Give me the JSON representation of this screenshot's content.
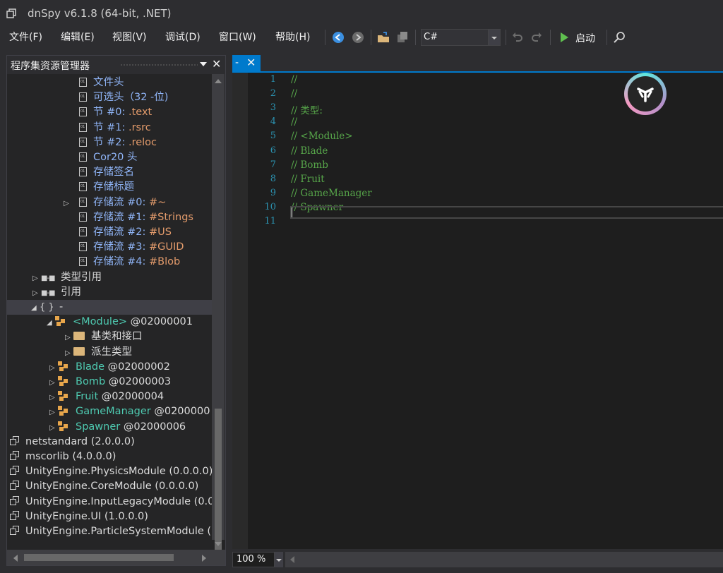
{
  "window": {
    "title": "dnSpy v6.1.8 (64-bit, .NET)"
  },
  "menu": [
    {
      "label": "文件(F)"
    },
    {
      "label": "编辑(E)"
    },
    {
      "label": "视图(V)"
    },
    {
      "label": "调试(D)"
    },
    {
      "label": "窗口(W)"
    },
    {
      "label": "帮助(H)"
    }
  ],
  "toolbar": {
    "language": "C#",
    "start_label": "启动",
    "icons": [
      "back-arrow-icon",
      "forward-arrow-icon",
      "open-folder-icon",
      "save-all-icon",
      "undo-icon",
      "redo-icon",
      "play-icon",
      "search-icon"
    ]
  },
  "explorer": {
    "title": "程序集资源管理器",
    "close": "✕",
    "rows": [
      {
        "icon": "file",
        "parts": [
          {
            "t": "文件头",
            "c": "blue"
          }
        ]
      },
      {
        "icon": "file",
        "parts": [
          {
            "t": "可选头（32 -位)",
            "c": "blue"
          }
        ]
      },
      {
        "icon": "file",
        "parts": [
          {
            "t": "节 #0: ",
            "c": "blue"
          },
          {
            "t": ".text",
            "c": "org"
          }
        ]
      },
      {
        "icon": "file",
        "parts": [
          {
            "t": "节 #1: ",
            "c": "blue"
          },
          {
            "t": ".rsrc",
            "c": "org"
          }
        ]
      },
      {
        "icon": "file",
        "parts": [
          {
            "t": "节 #2: ",
            "c": "blue"
          },
          {
            "t": ".reloc",
            "c": "org"
          }
        ]
      },
      {
        "icon": "file",
        "parts": [
          {
            "t": "Cor20 头",
            "c": "blue"
          }
        ]
      },
      {
        "icon": "file",
        "parts": [
          {
            "t": "存储签名",
            "c": "blue"
          }
        ]
      },
      {
        "icon": "file",
        "parts": [
          {
            "t": "存储标题",
            "c": "blue"
          }
        ]
      },
      {
        "icon": "file",
        "exp": "▷",
        "parts": [
          {
            "t": "存储流 #0: ",
            "c": "blue"
          },
          {
            "t": "#~",
            "c": "org"
          }
        ]
      },
      {
        "icon": "file",
        "parts": [
          {
            "t": "存储流 #1: ",
            "c": "blue"
          },
          {
            "t": "#Strings",
            "c": "org"
          }
        ]
      },
      {
        "icon": "file",
        "parts": [
          {
            "t": "存储流 #2: ",
            "c": "blue"
          },
          {
            "t": "#US",
            "c": "org"
          }
        ]
      },
      {
        "icon": "file",
        "parts": [
          {
            "t": "存储流 #3: ",
            "c": "blue"
          },
          {
            "t": "#GUID",
            "c": "org"
          }
        ]
      },
      {
        "icon": "file",
        "parts": [
          {
            "t": "存储流 #4: ",
            "c": "blue"
          },
          {
            "t": "#Blob",
            "c": "org"
          }
        ]
      },
      {
        "icon": "ref",
        "exp": "▷",
        "parts": [
          {
            "t": "类型引用",
            "c": "wh"
          }
        ]
      },
      {
        "icon": "ref",
        "exp": "▷",
        "parts": [
          {
            "t": "引用",
            "c": "wh"
          }
        ]
      },
      {
        "icon": "ns",
        "exp": "◢",
        "selected": true,
        "parts": [
          {
            "t": "-",
            "c": "wh"
          }
        ]
      },
      {
        "icon": "cls",
        "exp": "◢",
        "parts": [
          {
            "t": "<Module>",
            "c": "teal"
          },
          {
            "t": " @02000001",
            "c": "wh"
          }
        ]
      },
      {
        "icon": "folder",
        "exp": "▷",
        "parts": [
          {
            "t": "基类和接口",
            "c": "wh"
          }
        ]
      },
      {
        "icon": "folder",
        "exp": "▷",
        "parts": [
          {
            "t": "派生类型",
            "c": "wh"
          }
        ]
      },
      {
        "icon": "cls",
        "exp": "▷",
        "parts": [
          {
            "t": "Blade",
            "c": "teal"
          },
          {
            "t": " @02000002",
            "c": "wh"
          }
        ]
      },
      {
        "icon": "cls",
        "exp": "▷",
        "parts": [
          {
            "t": "Bomb",
            "c": "teal"
          },
          {
            "t": " @02000003",
            "c": "wh"
          }
        ]
      },
      {
        "icon": "cls",
        "exp": "▷",
        "parts": [
          {
            "t": "Fruit",
            "c": "teal"
          },
          {
            "t": " @02000004",
            "c": "wh"
          }
        ]
      },
      {
        "icon": "cls",
        "exp": "▷",
        "parts": [
          {
            "t": "GameManager",
            "c": "teal"
          },
          {
            "t": " @0200000",
            "c": "wh"
          }
        ]
      },
      {
        "icon": "cls",
        "exp": "▷",
        "parts": [
          {
            "t": "Spawner",
            "c": "teal"
          },
          {
            "t": " @02000006",
            "c": "wh"
          }
        ]
      },
      {
        "icon": "asm",
        "parts": [
          {
            "t": "netstandard (2.0.0.0)",
            "c": "wh"
          }
        ]
      },
      {
        "icon": "asm",
        "parts": [
          {
            "t": "mscorlib (4.0.0.0)",
            "c": "wh"
          }
        ]
      },
      {
        "icon": "asm",
        "parts": [
          {
            "t": "UnityEngine.PhysicsModule (0.0.0.0)",
            "c": "wh"
          }
        ]
      },
      {
        "icon": "asm",
        "parts": [
          {
            "t": "UnityEngine.CoreModule (0.0.0.0)",
            "c": "wh"
          }
        ]
      },
      {
        "icon": "asm",
        "parts": [
          {
            "t": "UnityEngine.InputLegacyModule (0.0",
            "c": "wh"
          }
        ]
      },
      {
        "icon": "asm",
        "parts": [
          {
            "t": "UnityEngine.UI (1.0.0.0)",
            "c": "wh"
          }
        ]
      },
      {
        "icon": "asm",
        "parts": [
          {
            "t": "UnityEngine.ParticleSystemModule (",
            "c": "wh"
          }
        ]
      }
    ]
  },
  "editor": {
    "tab": {
      "label": "-",
      "close": "✕"
    },
    "lines": [
      {
        "n": "1",
        "text": "//"
      },
      {
        "n": "2",
        "text": "//"
      },
      {
        "n": "3",
        "text": "// 类型:"
      },
      {
        "n": "4",
        "text": "//"
      },
      {
        "n": "5",
        "text": "// <Module>"
      },
      {
        "n": "6",
        "text": "// Blade"
      },
      {
        "n": "7",
        "text": "// Bomb"
      },
      {
        "n": "8",
        "text": "// Fruit"
      },
      {
        "n": "9",
        "text": "// GameManager"
      },
      {
        "n": "10",
        "text": "// Spawner"
      },
      {
        "n": "11",
        "text": ""
      }
    ],
    "zoom": "100 %"
  },
  "colors": {
    "accent": "#007acc",
    "background": "#2d2d30",
    "editor_bg": "#1e1e1e",
    "comment": "#57a64a",
    "line_number": "#2b91af"
  }
}
